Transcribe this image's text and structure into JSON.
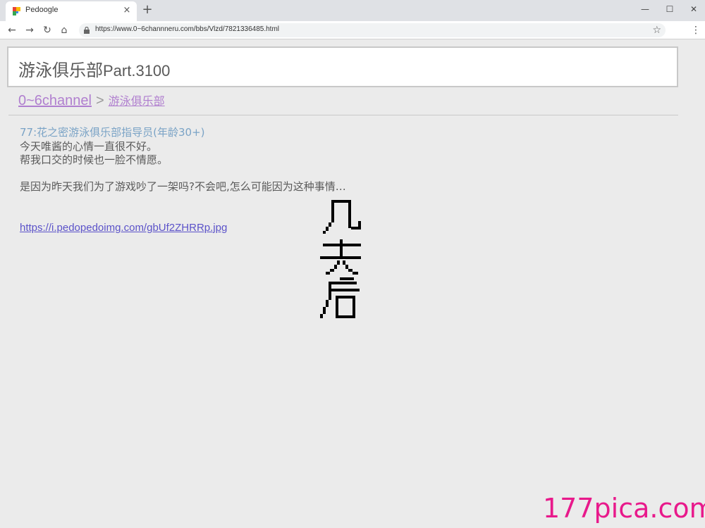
{
  "browser": {
    "tab": {
      "title": "Pedoogle",
      "close_icon": "close-icon",
      "favicon": "pedoogle-favicon"
    },
    "new_tab_icon": "plus-icon",
    "window_controls": [
      "minimize-icon",
      "maximize-icon",
      "close-icon"
    ],
    "toolbar": {
      "back_icon": "arrow-left-icon",
      "forward_icon": "arrow-right-icon",
      "reload_icon": "reload-icon",
      "home_icon": "home-icon",
      "url": "https://www.0~6channneru.com/bbs/Vlzd/7821336485.html",
      "bookmark_icon": "star-icon",
      "menu_icon": "kebab-menu-icon"
    }
  },
  "page": {
    "title_zh": "游泳俱乐部",
    "title_part": "Part.3100",
    "breadcrumb": {
      "home": "0~6channel",
      "separator": ">",
      "current": "游泳俱乐部"
    },
    "post": {
      "header": "77:花之密游泳俱乐部指导员(年龄30+)",
      "lines": [
        "今天唯酱的心情一直很不好。",
        "帮我口交的时候也一脸不情愿。",
        "",
        "是因为昨天我们为了游戏吵了一架吗?不会吧,怎么可能因为这种事情…"
      ],
      "link": "https://i.pedopedoimg.com/gbUf2ZHRRp.jpg"
    },
    "pixel_art_text": "几天后"
  },
  "watermark": "177pica.com",
  "colors": {
    "background": "#ebebeb",
    "link_purple": "#b07fcf",
    "post_header_blue": "#7aa3c6",
    "body_text": "#5a5a5a",
    "url_link": "#5b52c9",
    "watermark": "#e8198b"
  }
}
